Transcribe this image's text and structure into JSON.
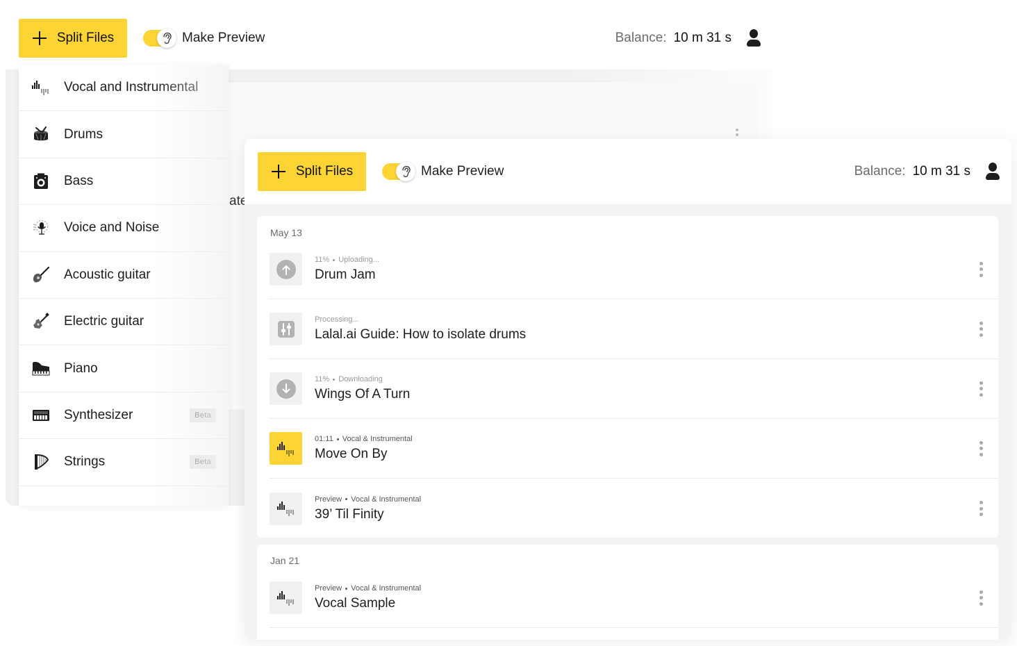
{
  "back_window": {
    "toolbar": {
      "split_label": "Split Files",
      "preview_label": "Make Preview",
      "balance_label": "Balance:",
      "balance_value": "10 m 31 s"
    },
    "ghost_text": "ate"
  },
  "dropdown": {
    "items": [
      {
        "label": "Vocal and Instrumental",
        "icon": "waveform-icon",
        "badge": ""
      },
      {
        "label": "Drums",
        "icon": "drum-icon",
        "badge": ""
      },
      {
        "label": "Bass",
        "icon": "speaker-icon",
        "badge": ""
      },
      {
        "label": "Voice and Noise",
        "icon": "microphone-noise-icon",
        "badge": ""
      },
      {
        "label": "Acoustic guitar",
        "icon": "acoustic-guitar-icon",
        "badge": ""
      },
      {
        "label": "Electric guitar",
        "icon": "electric-guitar-icon",
        "badge": ""
      },
      {
        "label": "Piano",
        "icon": "piano-icon",
        "badge": ""
      },
      {
        "label": "Synthesizer",
        "icon": "synthesizer-icon",
        "badge": "Beta"
      },
      {
        "label": "Strings",
        "icon": "harp-icon",
        "badge": "Beta"
      }
    ]
  },
  "front_window": {
    "toolbar": {
      "split_label": "Split Files",
      "preview_label": "Make Preview",
      "balance_label": "Balance:",
      "balance_value": "10 m 31 s"
    },
    "groups": [
      {
        "date": "May 13",
        "files": [
          {
            "meta": [
              "11%",
              "Uploading..."
            ],
            "name": "Drum Jam",
            "thumb": "upload-icon",
            "highlight": false
          },
          {
            "meta": [
              "Processing..."
            ],
            "name": "Lalal.ai Guide: How to isolate drums",
            "thumb": "mixer-icon",
            "highlight": false
          },
          {
            "meta": [
              "11%",
              "Downloading"
            ],
            "name": "Wings Of A Turn",
            "thumb": "download-icon",
            "highlight": false
          },
          {
            "meta": [
              "01:11",
              "Vocal & Instrumental"
            ],
            "name": "Move On By",
            "thumb": "waveform-icon",
            "highlight": true
          },
          {
            "meta": [
              "Preview",
              "Vocal & Instrumental"
            ],
            "name": "39’ Til Finity",
            "thumb": "waveform-icon",
            "highlight": false
          }
        ]
      },
      {
        "date": "Jan 21",
        "files": [
          {
            "meta": [
              "Preview",
              "Vocal & Instrumental"
            ],
            "name": "Vocal Sample",
            "thumb": "waveform-icon",
            "highlight": false
          }
        ]
      }
    ]
  },
  "colors": {
    "accent": "#fcd535",
    "text": "#1d1d1d",
    "muted": "#6b6b6b",
    "panel": "#f3f3f3"
  }
}
